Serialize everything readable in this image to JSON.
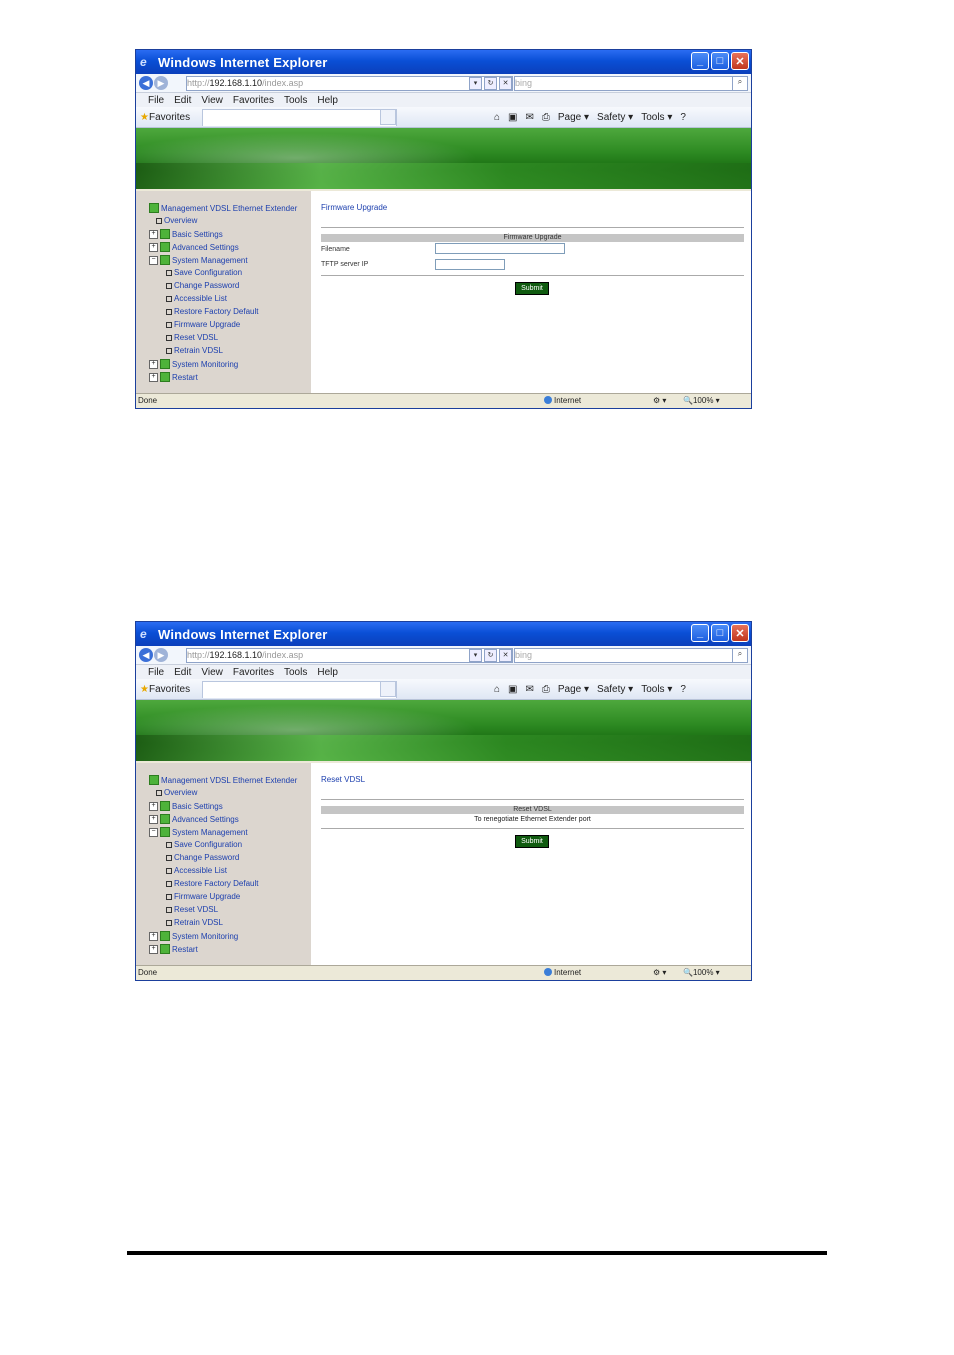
{
  "window": {
    "title": "Windows Internet Explorer",
    "minimize": "_",
    "maximize": "□",
    "close": "✕"
  },
  "address": {
    "scheme": "http://",
    "host": "192.168.1.10",
    "path": "/index.asp",
    "search_placeholder": "bing"
  },
  "menu": [
    "File",
    "Edit",
    "View",
    "Favorites",
    "Tools",
    "Help"
  ],
  "favorites_label": "Favorites",
  "commands": [
    "Page ▾",
    "Safety ▾",
    "Tools ▾"
  ],
  "sidebar": {
    "root": "Management VDSL Ethernet Extender",
    "overview": "Overview",
    "basic": "Basic Settings",
    "advanced": "Advanced Settings",
    "system": "System Management",
    "sub": [
      "Save Configuration",
      "Change Password",
      "Accessible List",
      "Restore Factory Default",
      "Firmware Upgrade",
      "Reset VDSL",
      "Retrain VDSL"
    ],
    "monitoring": "System Monitoring",
    "restart": "Restart"
  },
  "page1": {
    "title": "Firmware Upgrade",
    "table_header": "Firmware Upgrade",
    "filename_label": "Filename",
    "tftp_label": "TFTP server IP",
    "submit": "Submit"
  },
  "page2": {
    "title": "Reset VDSL",
    "table_header": "Reset VDSL",
    "note": "To renegotiate Ethernet Extender port",
    "submit": "Submit"
  },
  "status": {
    "left": "Done",
    "zone": "Internet",
    "zoom": "100%"
  }
}
